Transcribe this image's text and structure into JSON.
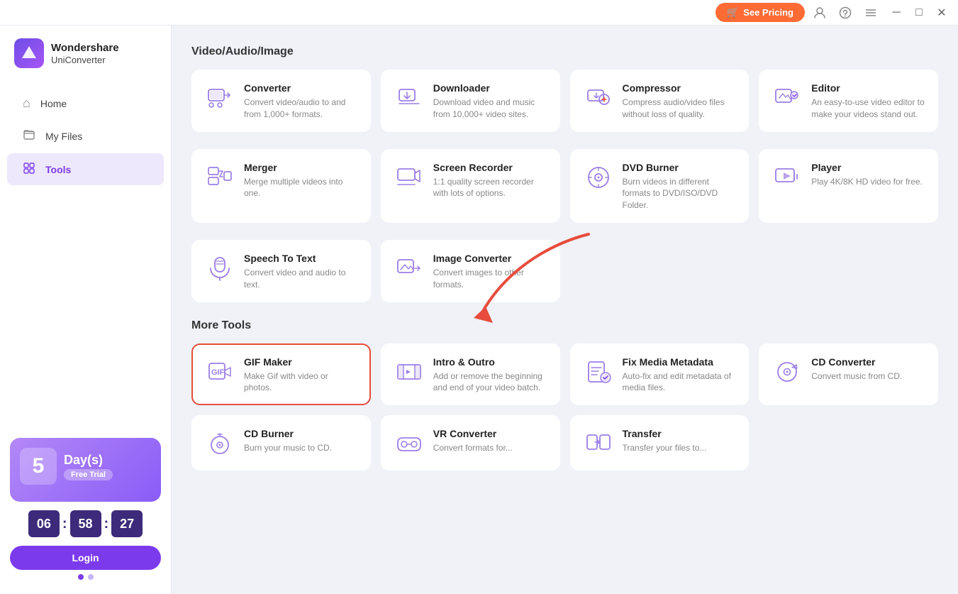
{
  "titleBar": {
    "seePricing": "See Pricing",
    "cartIcon": "🛒",
    "minimizeIcon": "─",
    "maximizeIcon": "□",
    "closeIcon": "✕"
  },
  "logo": {
    "brand": "Wondershare",
    "product": "UniConverter"
  },
  "sidebar": {
    "items": [
      {
        "id": "home",
        "label": "Home",
        "icon": "⌂"
      },
      {
        "id": "myfiles",
        "label": "My Files",
        "icon": "🗂"
      },
      {
        "id": "tools",
        "label": "Tools",
        "icon": "💼",
        "active": true
      }
    ],
    "trial": {
      "days": "5",
      "daysLabel": "Day(s)",
      "badge": "Free Trial",
      "timer": {
        "hours": "06",
        "minutes": "58",
        "seconds": "27"
      },
      "loginLabel": "Login"
    },
    "dots": [
      true,
      false
    ]
  },
  "sections": {
    "videoAudioImage": {
      "title": "Video/Audio/Image",
      "tools": [
        {
          "id": "converter",
          "name": "Converter",
          "desc": "Convert video/audio to and from 1,000+ formats."
        },
        {
          "id": "downloader",
          "name": "Downloader",
          "desc": "Download video and music from 10,000+ video sites."
        },
        {
          "id": "compressor",
          "name": "Compressor",
          "desc": "Compress audio/video files without loss of quality."
        },
        {
          "id": "editor",
          "name": "Editor",
          "desc": "An easy-to-use video editor to make your videos stand out."
        },
        {
          "id": "merger",
          "name": "Merger",
          "desc": "Merge multiple videos into one."
        },
        {
          "id": "screen-recorder",
          "name": "Screen Recorder",
          "desc": "1:1 quality screen recorder with lots of options."
        },
        {
          "id": "dvd-burner",
          "name": "DVD Burner",
          "desc": "Burn videos in different formats to DVD/ISO/DVD Folder."
        },
        {
          "id": "player",
          "name": "Player",
          "desc": "Play 4K/8K HD video for free."
        },
        {
          "id": "speech-to-text",
          "name": "Speech To Text",
          "desc": "Convert video and audio to text."
        },
        {
          "id": "image-converter",
          "name": "Image Converter",
          "desc": "Convert images to other formats."
        }
      ]
    },
    "moreTools": {
      "title": "More Tools",
      "tools": [
        {
          "id": "gif-maker",
          "name": "GIF Maker",
          "desc": "Make Gif with video or photos.",
          "highlighted": true
        },
        {
          "id": "intro-outro",
          "name": "Intro & Outro",
          "desc": "Add or remove the beginning and end of your video batch."
        },
        {
          "id": "fix-media-metadata",
          "name": "Fix Media Metadata",
          "desc": "Auto-fix and edit metadata of media files."
        },
        {
          "id": "cd-converter",
          "name": "CD Converter",
          "desc": "Convert music from CD."
        },
        {
          "id": "cd-burner-more",
          "name": "CD Burner",
          "desc": "Burn your music to CD."
        },
        {
          "id": "vr-converter",
          "name": "VR Converter",
          "desc": "Convert formats for..."
        },
        {
          "id": "transfer",
          "name": "Transfer",
          "desc": "Transfer your files to..."
        }
      ]
    }
  }
}
